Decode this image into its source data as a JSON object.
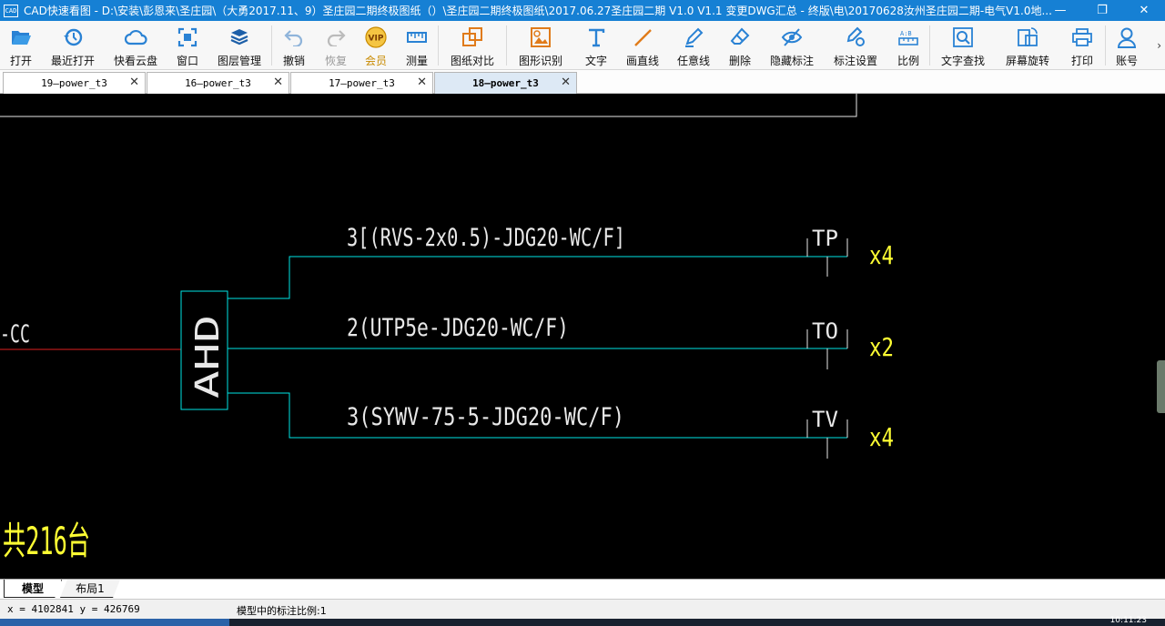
{
  "window": {
    "app_icon_text": "CAD",
    "title": "CAD快速看图 - D:\\安装\\彭恩来\\圣庄园\\（大勇2017.11、9）圣庄园二期终极图纸（）\\圣庄园二期终极图纸\\2017.06.27圣庄园二期 V1.0 V1.1 变更DWG汇总 - 终版\\电\\20170628汝州圣庄园二期-电气V1.0地...",
    "minimize": "—",
    "restore": "❐",
    "close": "✕"
  },
  "toolbar": {
    "open": "打开",
    "recent": "最近打开",
    "cloud": "快看云盘",
    "window": "窗口",
    "layers": "图层管理",
    "undo": "撤销",
    "redo": "恢复",
    "vip": "会员",
    "measure": "测量",
    "compare": "图纸对比",
    "recognize": "图形识别",
    "text": "文字",
    "line": "画直线",
    "freeline": "任意线",
    "erase": "删除",
    "hide_marks": "隐藏标注",
    "mark_settings": "标注设置",
    "scale": "比例",
    "find_text": "文字查找",
    "rotate": "屏幕旋转",
    "print": "打印",
    "account": "账号",
    "more": "›",
    "vip_badge": "VIP"
  },
  "tabs": [
    {
      "label": "19—power_t3",
      "close": "✕"
    },
    {
      "label": "16—power_t3",
      "close": "✕"
    },
    {
      "label": "17—power_t3",
      "close": "✕"
    },
    {
      "label": "18—power_t3",
      "close": "✕"
    }
  ],
  "drawing": {
    "left_label": "-CC",
    "box_label": "AHD",
    "lines": [
      {
        "cable": "3[(RVS-2x0.5)-JDG20-WC/F]",
        "terminal": "TP",
        "count": "x4"
      },
      {
        "cable": "2(UTP5e-JDG20-WC/F)",
        "terminal": "TO",
        "count": "x2"
      },
      {
        "cable": "3(SYWV-75-5-JDG20-WC/F)",
        "terminal": "TV",
        "count": "x4"
      }
    ],
    "total": "共216台",
    "colors": {
      "cyan": "#00e5e5",
      "red": "#e02020",
      "yellow": "#ffff33",
      "white": "#e8e8e8"
    }
  },
  "layout_tabs": {
    "model": "模型",
    "layout1": "布局1"
  },
  "status": {
    "coords": "x = 4102841  y = 426769",
    "scale": "模型中的标注比例:1"
  },
  "taskbar": {
    "clock": "10:11:23"
  }
}
